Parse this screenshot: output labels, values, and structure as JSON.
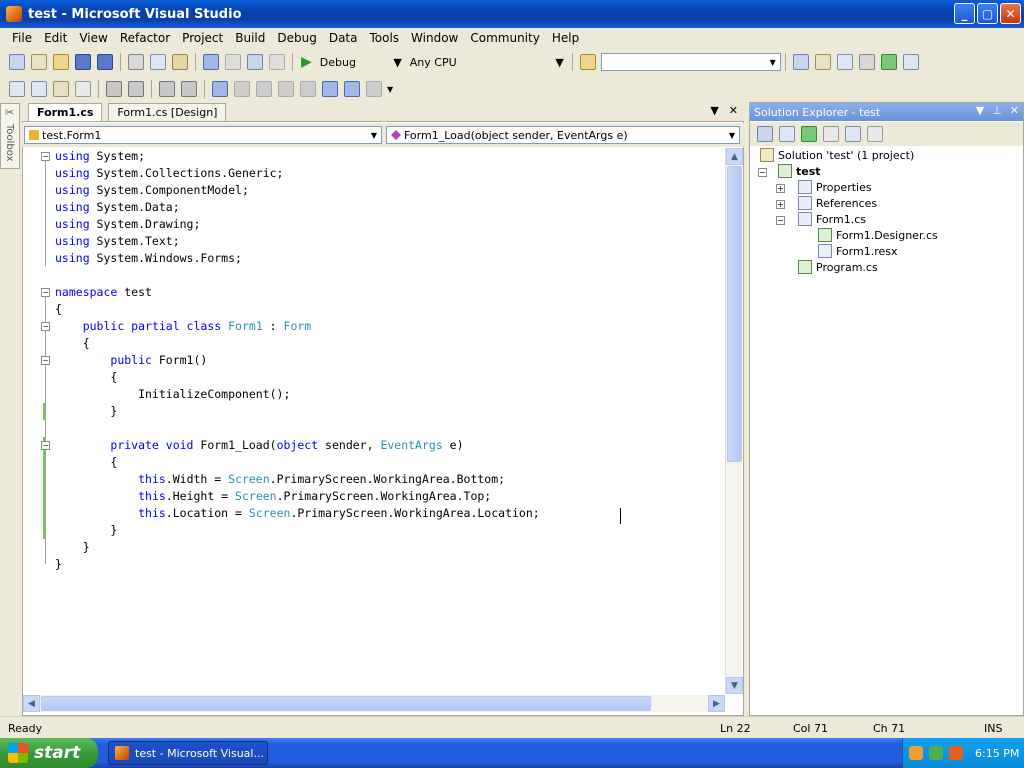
{
  "window": {
    "title": "test - Microsoft Visual Studio"
  },
  "menu": [
    "File",
    "Edit",
    "View",
    "Refactor",
    "Project",
    "Build",
    "Debug",
    "Data",
    "Tools",
    "Window",
    "Community",
    "Help"
  ],
  "toolbar": {
    "config": "Debug",
    "platform": "Any CPU"
  },
  "sidebar": {
    "toolbox_label": "Toolbox"
  },
  "tabs": [
    {
      "label": "Form1.cs",
      "active": true
    },
    {
      "label": "Form1.cs [Design]",
      "active": false
    }
  ],
  "navbar": {
    "type_combo": "test.Form1",
    "member_combo": "Form1_Load(object sender, EventArgs e)"
  },
  "code_lines": [
    [
      [
        "kw",
        "using"
      ],
      [
        "t",
        " System;"
      ]
    ],
    [
      [
        "kw",
        "using"
      ],
      [
        "t",
        " System.Collections.Generic;"
      ]
    ],
    [
      [
        "kw",
        "using"
      ],
      [
        "t",
        " System.ComponentModel;"
      ]
    ],
    [
      [
        "kw",
        "using"
      ],
      [
        "t",
        " System.Data;"
      ]
    ],
    [
      [
        "kw",
        "using"
      ],
      [
        "t",
        " System.Drawing;"
      ]
    ],
    [
      [
        "kw",
        "using"
      ],
      [
        "t",
        " System.Text;"
      ]
    ],
    [
      [
        "kw",
        "using"
      ],
      [
        "t",
        " System.Windows.Forms;"
      ]
    ],
    [],
    [
      [
        "kw",
        "namespace"
      ],
      [
        "t",
        " test"
      ]
    ],
    [
      [
        "t",
        "{"
      ]
    ],
    [
      [
        "t",
        "    "
      ],
      [
        "kw",
        "public partial class"
      ],
      [
        "t",
        " "
      ],
      [
        "ty",
        "Form1"
      ],
      [
        "t",
        " : "
      ],
      [
        "ty",
        "Form"
      ]
    ],
    [
      [
        "t",
        "    {"
      ]
    ],
    [
      [
        "t",
        "        "
      ],
      [
        "kw",
        "public"
      ],
      [
        "t",
        " Form1()"
      ]
    ],
    [
      [
        "t",
        "        {"
      ]
    ],
    [
      [
        "t",
        "            InitializeComponent();"
      ]
    ],
    [
      [
        "t",
        "        }"
      ]
    ],
    [],
    [
      [
        "t",
        "        "
      ],
      [
        "kw",
        "private void"
      ],
      [
        "t",
        " Form1_Load("
      ],
      [
        "kw",
        "object"
      ],
      [
        "t",
        " sender, "
      ],
      [
        "ty",
        "EventArgs"
      ],
      [
        "t",
        " e)"
      ]
    ],
    [
      [
        "t",
        "        {"
      ]
    ],
    [
      [
        "t",
        "            "
      ],
      [
        "kw",
        "this"
      ],
      [
        "t",
        ".Width = "
      ],
      [
        "ty",
        "Screen"
      ],
      [
        "t",
        ".PrimaryScreen.WorkingArea.Bottom;"
      ]
    ],
    [
      [
        "t",
        "            "
      ],
      [
        "kw",
        "this"
      ],
      [
        "t",
        ".Height = "
      ],
      [
        "ty",
        "Screen"
      ],
      [
        "t",
        ".PrimaryScreen.WorkingArea.Top;"
      ]
    ],
    [
      [
        "t",
        "            "
      ],
      [
        "kw",
        "this"
      ],
      [
        "t",
        ".Location = "
      ],
      [
        "ty",
        "Screen"
      ],
      [
        "t",
        ".PrimaryScreen.WorkingArea.Location;"
      ]
    ],
    [
      [
        "t",
        "        }"
      ]
    ],
    [
      [
        "t",
        "    }"
      ]
    ],
    [
      [
        "t",
        "}"
      ]
    ]
  ],
  "solution_explorer": {
    "title": "Solution Explorer - test",
    "items": [
      {
        "label": "Solution 'test' (1 project)",
        "icon": "solution-icon"
      },
      {
        "label": "test",
        "icon": "csharp-project-icon"
      },
      {
        "label": "Properties",
        "icon": "properties-folder-icon"
      },
      {
        "label": "References",
        "icon": "references-folder-icon"
      },
      {
        "label": "Form1.cs",
        "icon": "form-icon"
      },
      {
        "label": "Form1.Designer.cs",
        "icon": "cs-file-icon"
      },
      {
        "label": "Form1.resx",
        "icon": "resx-file-icon"
      },
      {
        "label": "Program.cs",
        "icon": "cs-file-icon"
      }
    ]
  },
  "status": {
    "text": "Ready",
    "ln": "Ln 22",
    "col": "Col 71",
    "ch": "Ch 71",
    "mode": "INS"
  },
  "taskbar": {
    "start": "start",
    "task": "test - Microsoft Visual...",
    "clock": "6:15 PM"
  }
}
